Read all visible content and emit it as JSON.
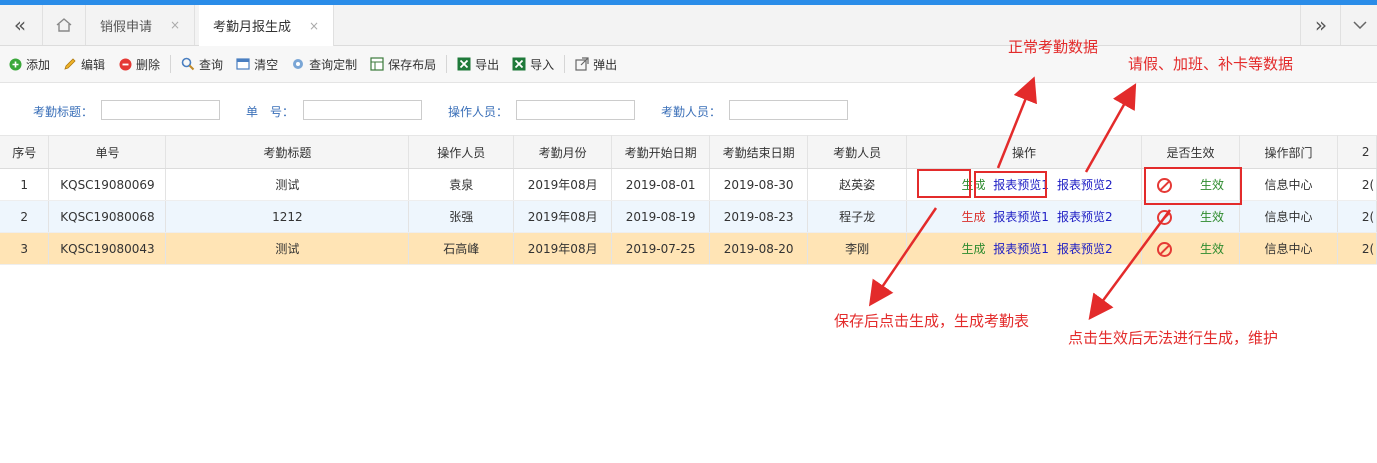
{
  "tabs": [
    {
      "label": "销假申请",
      "close": "×"
    },
    {
      "label": "考勤月报生成",
      "close": "×"
    }
  ],
  "toolbar": {
    "add": "添加",
    "edit": "编辑",
    "delete": "删除",
    "query": "查询",
    "clear": "清空",
    "query_custom": "查询定制",
    "save_layout": "保存布局",
    "export": "导出",
    "import": "导入",
    "popup": "弹出"
  },
  "search": {
    "title_label": "考勤标题：",
    "no_label": "单　号：",
    "operator_label": "操作人员：",
    "staff_label": "考勤人员："
  },
  "columns": [
    "序号",
    "单号",
    "考勤标题",
    "操作人员",
    "考勤月份",
    "考勤开始日期",
    "考勤结束日期",
    "考勤人员",
    "操作",
    "是否生效",
    "操作部门",
    "2"
  ],
  "rows": [
    {
      "idx": "1",
      "no": "KQSC19080069",
      "title": "测试",
      "operator": "袁泉",
      "month": "2019年08月",
      "start": "2019-08-01",
      "end": "2019-08-30",
      "staff": "赵英姿",
      "gen": "生成",
      "preview1": "报表预览1",
      "preview2": "报表预览2",
      "effective": "生效",
      "dept": "信息中心",
      "extra": "2("
    },
    {
      "idx": "2",
      "no": "KQSC19080068",
      "title": "1212",
      "operator": "张强",
      "month": "2019年08月",
      "start": "2019-08-19",
      "end": "2019-08-23",
      "staff": "程子龙",
      "gen": "生成",
      "preview1": "报表预览1",
      "preview2": "报表预览2",
      "effective": "生效",
      "dept": "信息中心",
      "extra": "2("
    },
    {
      "idx": "3",
      "no": "KQSC19080043",
      "title": "测试",
      "operator": "石高峰",
      "month": "2019年08月",
      "start": "2019-07-25",
      "end": "2019-08-20",
      "staff": "李刚",
      "gen": "生成",
      "preview1": "报表预览1",
      "preview2": "报表预览2",
      "effective": "生效",
      "dept": "信息中心",
      "extra": "2("
    }
  ],
  "annotations": {
    "normal": "正常考勤数据",
    "leave": "请假、加班、补卡等数据",
    "save_gen": "保存后点击生成，生成考勤表",
    "after_effect": "点击生效后无法进行生成，维护"
  },
  "colors": {
    "accent": "#2a8ce8",
    "annotation": "#e32b2b",
    "selected_row": "#ffe4b5"
  }
}
